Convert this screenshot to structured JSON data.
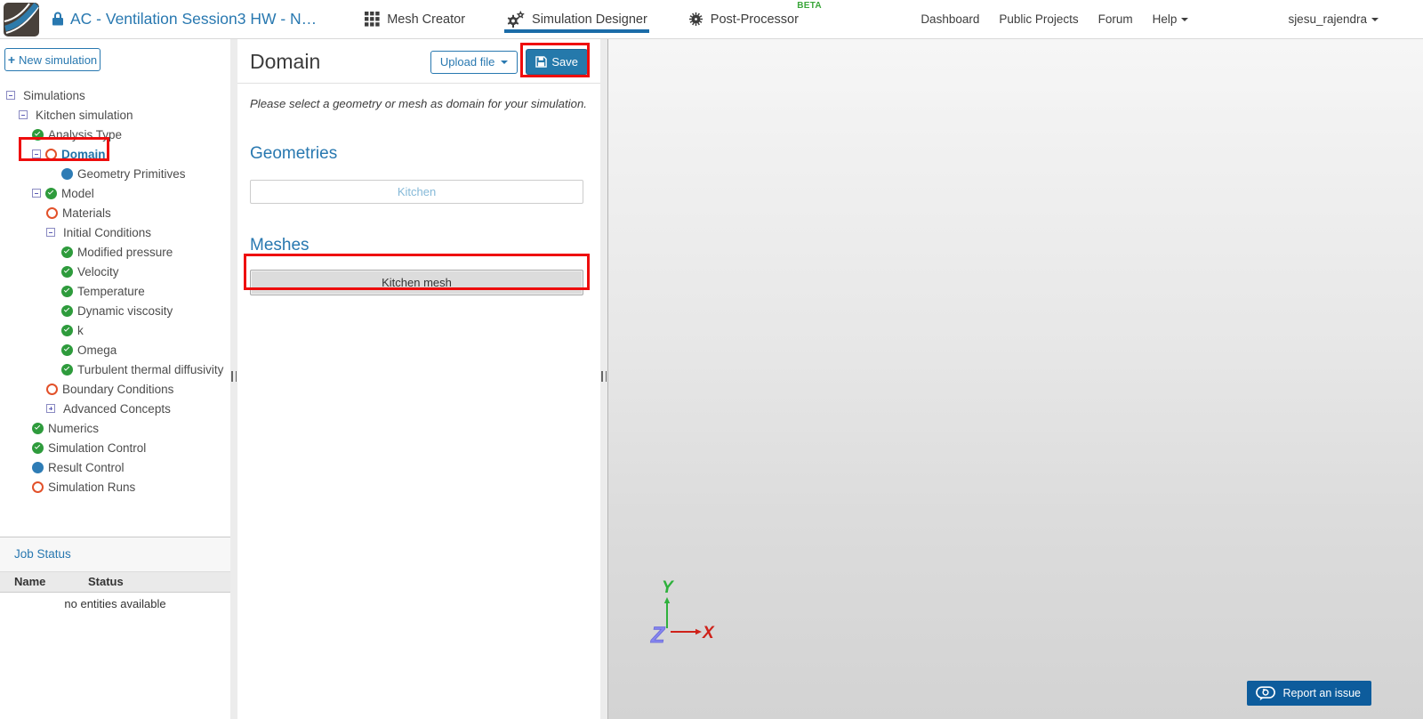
{
  "header": {
    "project_title": "AC - Ventilation Session3 HW - N…",
    "tabs": [
      {
        "label": "Mesh Creator",
        "icon": "grid-icon",
        "active": false
      },
      {
        "label": "Simulation Designer",
        "icon": "gears-icon",
        "active": true
      },
      {
        "label": "Post-Processor",
        "icon": "gear-sun-icon",
        "active": false,
        "badge": "BETA"
      }
    ],
    "links": [
      "Dashboard",
      "Public Projects",
      "Forum"
    ],
    "help_label": "Help",
    "username": "sjesu_rajendra"
  },
  "sidebar": {
    "new_simulation": {
      "icon": "+",
      "label": "New simulation"
    },
    "tree": [
      {
        "label": "Simulations",
        "level": 0,
        "toggle": "minus",
        "status": null,
        "selected": false
      },
      {
        "label": "Kitchen simulation",
        "level": 1,
        "toggle": "minus",
        "status": null,
        "selected": false
      },
      {
        "label": "Analysis Type",
        "level": 2,
        "toggle": null,
        "status": "check",
        "selected": false
      },
      {
        "label": "Domain",
        "level": 2,
        "toggle": "minus",
        "status": "todo",
        "selected": true
      },
      {
        "label": "Geometry Primitives",
        "level": 4,
        "toggle": null,
        "status": "info",
        "selected": false
      },
      {
        "label": "Model",
        "level": 2,
        "toggle": "minus",
        "status": "check",
        "selected": false
      },
      {
        "label": "Materials",
        "level": 3,
        "toggle": null,
        "status": "todo",
        "selected": false
      },
      {
        "label": "Initial Conditions",
        "level": 3,
        "toggle": "minus",
        "status": null,
        "selected": false
      },
      {
        "label": "Modified pressure",
        "level": 4,
        "toggle": null,
        "status": "check",
        "selected": false
      },
      {
        "label": "Velocity",
        "level": 4,
        "toggle": null,
        "status": "check",
        "selected": false
      },
      {
        "label": "Temperature",
        "level": 4,
        "toggle": null,
        "status": "check",
        "selected": false
      },
      {
        "label": "Dynamic viscosity",
        "level": 4,
        "toggle": null,
        "status": "check",
        "selected": false
      },
      {
        "label": "k",
        "level": 4,
        "toggle": null,
        "status": "check",
        "selected": false
      },
      {
        "label": "Omega",
        "level": 4,
        "toggle": null,
        "status": "check",
        "selected": false
      },
      {
        "label": "Turbulent thermal diffusivity",
        "level": 4,
        "toggle": null,
        "status": "check",
        "selected": false
      },
      {
        "label": "Boundary Conditions",
        "level": 3,
        "toggle": null,
        "status": "todo",
        "selected": false
      },
      {
        "label": "Advanced Concepts",
        "level": 3,
        "toggle": "plus",
        "status": null,
        "selected": false
      },
      {
        "label": "Numerics",
        "level": 2,
        "toggle": null,
        "status": "check",
        "selected": false
      },
      {
        "label": "Simulation Control",
        "level": 2,
        "toggle": null,
        "status": "check",
        "selected": false
      },
      {
        "label": "Result Control",
        "level": 2,
        "toggle": null,
        "status": "info",
        "selected": false
      },
      {
        "label": "Simulation Runs",
        "level": 2,
        "toggle": null,
        "status": "todo",
        "selected": false
      }
    ],
    "job_status": {
      "title": "Job Status",
      "columns": [
        "Name",
        "Status"
      ],
      "empty_message": "no entities available"
    }
  },
  "panel": {
    "title": "Domain",
    "upload_button": "Upload file",
    "save_button": "Save",
    "note": "Please select a geometry or mesh as domain for your simulation.",
    "sections": [
      {
        "heading": "Geometries",
        "items": [
          {
            "label": "Kitchen",
            "selected": false
          }
        ]
      },
      {
        "heading": "Meshes",
        "items": [
          {
            "label": "Kitchen mesh",
            "selected": true
          }
        ]
      }
    ]
  },
  "viewport": {
    "axis_labels": {
      "x": "X",
      "y": "Y",
      "z": "Z"
    },
    "axis_colors": {
      "x": "#cf221a",
      "y": "#2eb13c",
      "z": "#8585ef"
    },
    "report_button": "Report an issue"
  },
  "annotations": {
    "color": "#ee0d0d",
    "targets": [
      "domain-tree-item",
      "save-button",
      "kitchen-mesh-button"
    ]
  },
  "colors": {
    "accent": "#2878b0",
    "active_tab_underline": "#1b6ca8",
    "beta_green": "#3aa63a"
  }
}
